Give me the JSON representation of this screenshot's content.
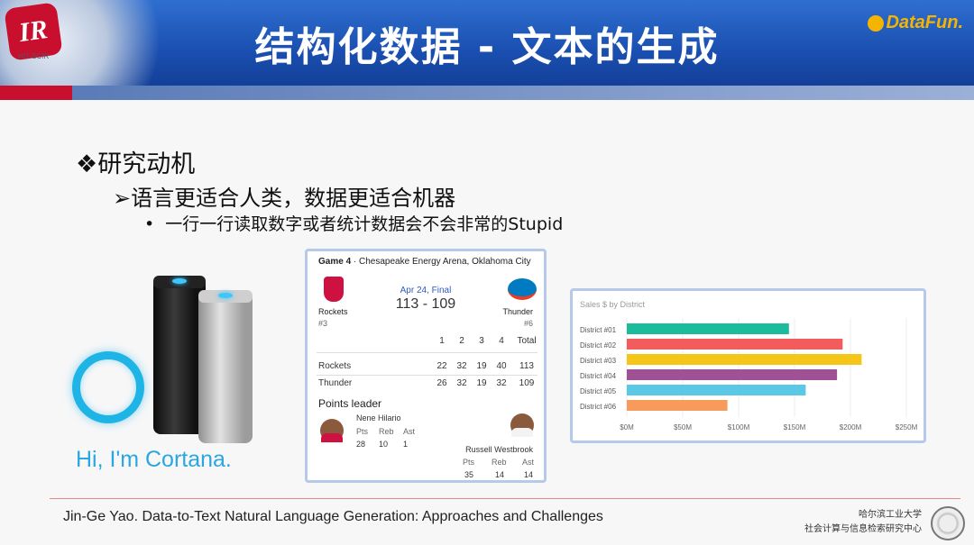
{
  "header": {
    "title": "结构化数据 - 文本的生成",
    "brand": "DataFun.",
    "logo_text": "IR",
    "logo_sub": "HIT-SCIR"
  },
  "content": {
    "heading": "❖研究动机",
    "subheading": "➢语言更适合人类，数据更适合机器",
    "bullet": "一行一行读取数字或者统计数据会不会非常的Stupid"
  },
  "cortana": {
    "text": "Hi, I'm Cortana."
  },
  "game": {
    "game_label": "Game 4",
    "venue": " · Chesapeake Energy Arena, Oklahoma City",
    "date": "Apr 24, Final",
    "score": "113 - 109",
    "home": {
      "name": "Rockets",
      "seed": "#3"
    },
    "away": {
      "name": "Thunder",
      "seed": "#6"
    },
    "quarter_headers": [
      "1",
      "2",
      "3",
      "4",
      "Total"
    ],
    "rows": [
      {
        "team": "Rockets",
        "scores": [
          "22",
          "32",
          "19",
          "40",
          "113"
        ]
      },
      {
        "team": "Thunder",
        "scores": [
          "26",
          "32",
          "19",
          "32",
          "109"
        ]
      }
    ],
    "points_leader_label": "Points leader",
    "leader1": {
      "name": "Nene Hilario",
      "cols": [
        "Pts",
        "Reb",
        "Ast"
      ],
      "vals": [
        "28",
        "10",
        "1"
      ]
    },
    "leader2": {
      "name": "Russell Westbrook",
      "cols": [
        "Pts",
        "Reb",
        "Ast"
      ],
      "vals": [
        "35",
        "14",
        "14"
      ]
    }
  },
  "chart_data": {
    "type": "bar",
    "orientation": "horizontal",
    "title": "Sales $ by District",
    "categories": [
      "District #01",
      "District #02",
      "District #03",
      "District #04",
      "District #05",
      "District #06"
    ],
    "values": [
      145,
      193,
      210,
      188,
      160,
      90
    ],
    "unit": "$M",
    "xlim": [
      0,
      250
    ],
    "xticks": [
      "$0M",
      "$50M",
      "$100M",
      "$150M",
      "$200M",
      "$250M"
    ],
    "colors": [
      "#1abc9c",
      "#f25c5c",
      "#f5c518",
      "#a05195",
      "#5bc8e6",
      "#f89b5a"
    ],
    "grid": true
  },
  "footer": {
    "citation": "Jin-Ge Yao. Data-to-Text Natural Language Generation: Approaches and Challenges",
    "school_line1": "哈尔滨工业大学",
    "school_line2": "社会计算与信息检索研究中心"
  }
}
